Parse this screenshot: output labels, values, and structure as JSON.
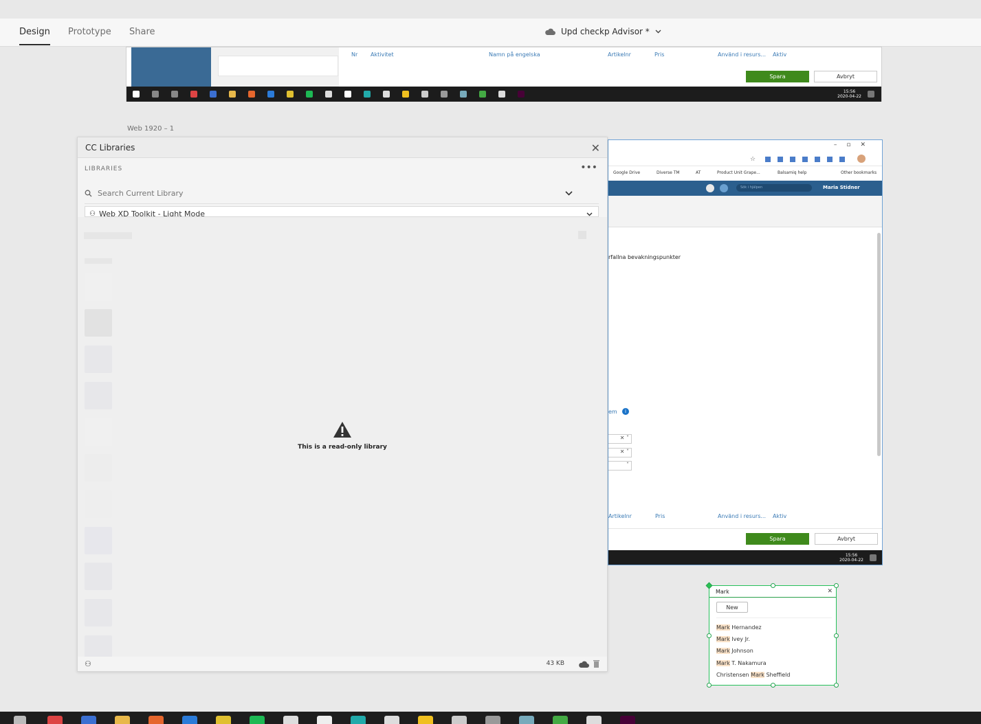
{
  "toolbar": {
    "tabs": [
      "Design",
      "Prototype",
      "Share"
    ],
    "document_title": "Upd checkp Advisor *"
  },
  "canvas": {
    "artboard_label": "Web 1920 – 1",
    "top_screenshot": {
      "columns": [
        "Nr",
        "Aktivitet",
        "Namn på engelska",
        "Artikelnr",
        "Pris",
        "Använd i resurs...",
        "Aktiv"
      ],
      "save_label": "Spara",
      "cancel_label": "Avbryt",
      "clock_time": "15:56",
      "clock_date": "2020-04-22"
    },
    "right_screenshot": {
      "bookmarks": [
        "Google Drive",
        "Diverse TM",
        "AT",
        "Product Unit Grape...",
        "Balsamiq help",
        "Other bookmarks"
      ],
      "search_placeholder": "Sök i hjälpen",
      "user_name": "Maria Stidner",
      "text_fragment": "rfallna bevakningspunkter",
      "text_fragment_2": "em",
      "columns": [
        "Artikelnr",
        "Pris",
        "Använd i resurs...",
        "Aktiv"
      ],
      "save_label": "Spara",
      "cancel_label": "Avbryt",
      "clock_time": "15:56",
      "clock_date": "2020-04-22"
    }
  },
  "cc_libraries": {
    "title": "CC Libraries",
    "section_label": "LIBRARIES",
    "search_placeholder": "Search Current Library",
    "selected_library": "Web XD Toolkit - Light Mode",
    "read_only_message": "This is a read-only library",
    "size": "43 KB"
  },
  "combo": {
    "input_value": "Mark",
    "new_label": "New",
    "items": [
      {
        "pre": "",
        "match": "Mark",
        "post": " Hernandez"
      },
      {
        "pre": "",
        "match": "Mark",
        "post": " Ivey Jr."
      },
      {
        "pre": "",
        "match": "Mark",
        "post": " Johnson"
      },
      {
        "pre": "",
        "match": "Mark",
        "post": " T. Nakamura"
      },
      {
        "pre": "Christensen ",
        "match": "Mark",
        "post": " Sheffield"
      }
    ]
  },
  "colors": {
    "accent_green": "#3f8a1c",
    "selection_green": "#24c05a",
    "nav_blue": "#2b5f8e",
    "link_blue": "#3a7ab5"
  }
}
